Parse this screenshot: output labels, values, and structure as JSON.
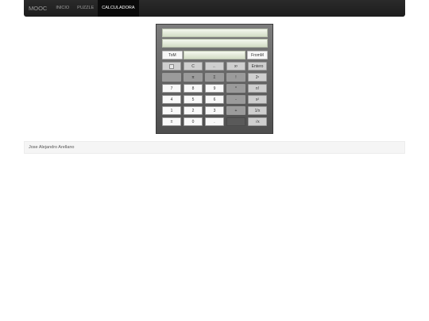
{
  "navbar": {
    "brand": "MOOC",
    "links": [
      "INICIO",
      "PUZZLE",
      "CALCULADORA"
    ],
    "active": "CALCULADORA"
  },
  "calculator": {
    "display_top": "",
    "display_bottom": "",
    "memory_row": {
      "left": "ToM",
      "display": "",
      "right": "FromM"
    },
    "rows": [
      [
        "img",
        "C",
        "←",
        "xʸ",
        "Entero"
      ],
      [
        "",
        "π",
        "Σ",
        "!",
        "2ˣ"
      ],
      [
        "7",
        "8",
        "9",
        "*",
        "n!"
      ],
      [
        "4",
        "5",
        "6",
        "-",
        "x²"
      ],
      [
        "1",
        "2",
        "3",
        "+",
        "1/x"
      ],
      [
        "±",
        "0",
        ".",
        "",
        "√x"
      ]
    ]
  },
  "footer": {
    "text": "Jose Alejandro Arellano"
  },
  "colors": {
    "navbar": "#222222",
    "active_tab": "#0a0a0a",
    "calculator_body": "#6a6a6a",
    "screen": "#e3e9da"
  }
}
